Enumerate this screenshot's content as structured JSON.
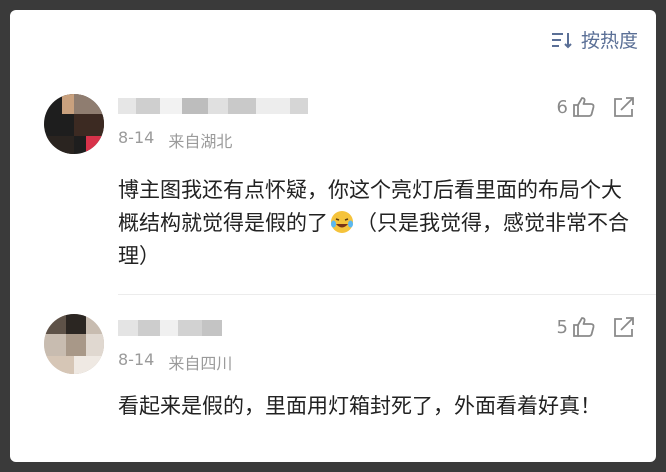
{
  "header": {
    "sort_label": "按热度",
    "sort_icon": "sort-icon"
  },
  "comments": [
    {
      "date": "8-14",
      "location": "来自湖北",
      "likes": "6",
      "text_before_emoji": "博主图我还有点怀疑，你这个亮灯后看里面的布局个大概结构就觉得是假的了",
      "emoji": "laughing-crying-emoji",
      "text_after_emoji": "（只是我觉得，感觉非常不合理）"
    },
    {
      "date": "8-14",
      "location": "来自四川",
      "likes": "5",
      "text": "看起来是假的，里面用灯箱封死了，外面看着好真！"
    }
  ],
  "colors": {
    "accent": "#5a6f96",
    "meta": "#9b9b9b",
    "body_text": "#222222"
  }
}
